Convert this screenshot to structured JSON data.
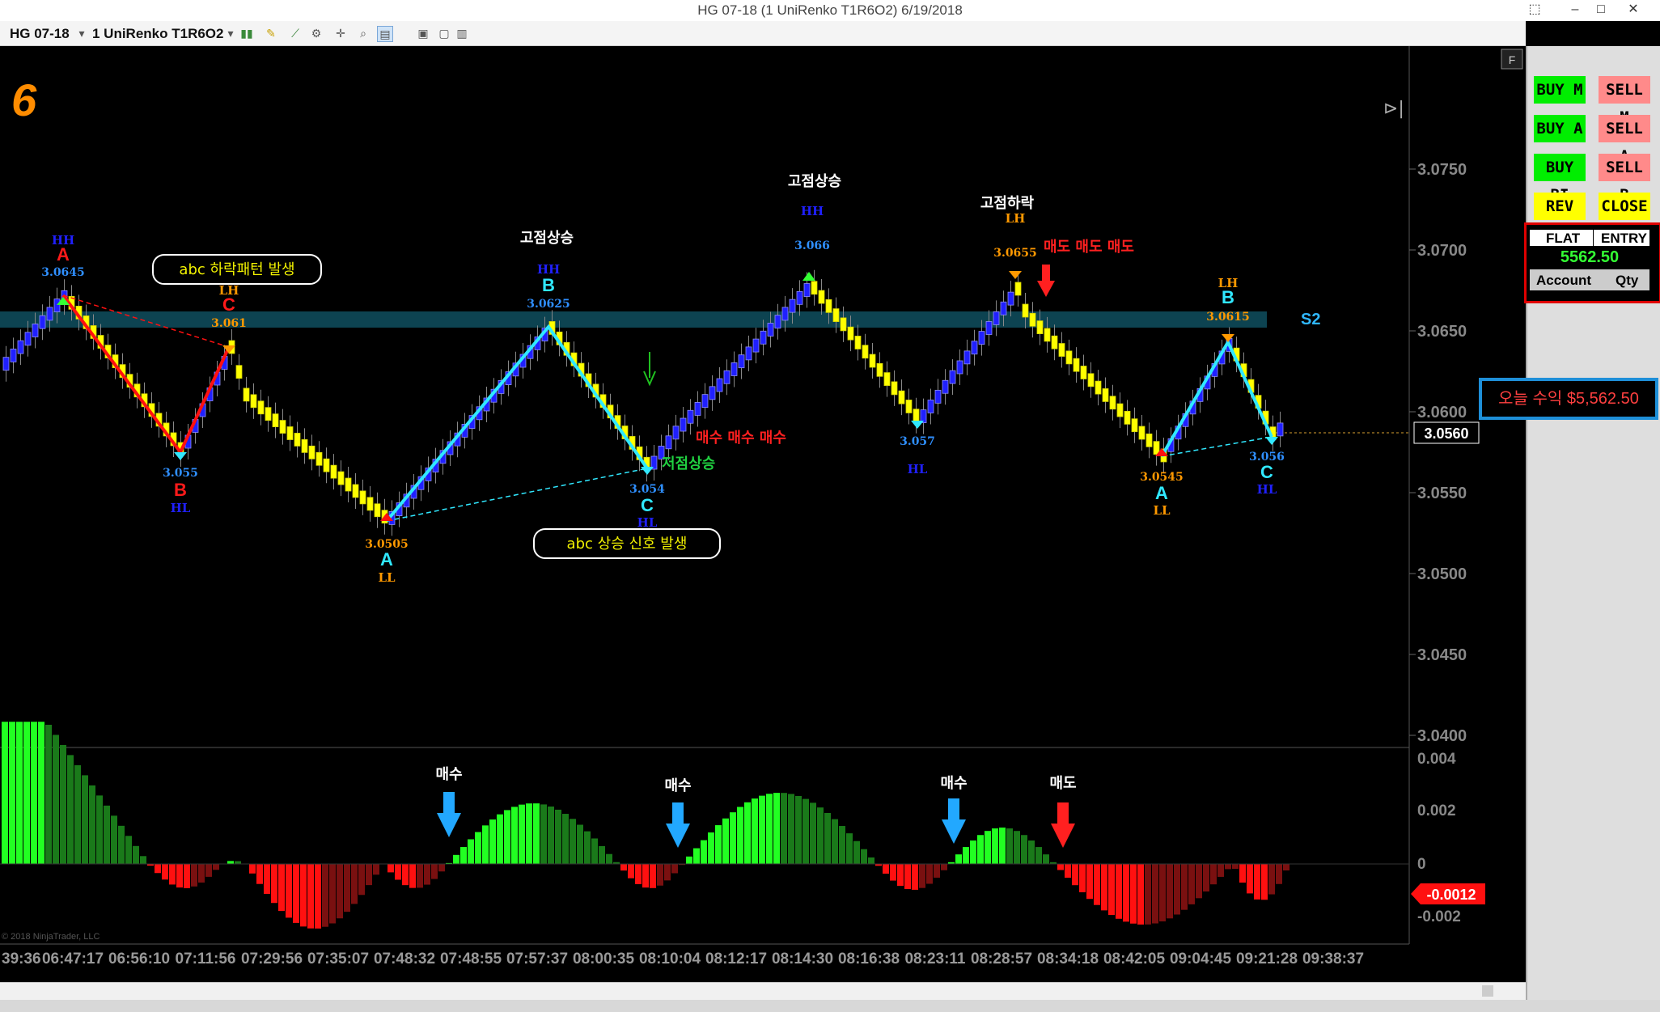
{
  "window": {
    "title": "HG 07-18 (1 UniRenko T1R6O2)  6/19/2018"
  },
  "toolbar": {
    "instrument": "HG 07-18",
    "bartype": "1 UniRenko T1R6O2"
  },
  "chart": {
    "tab_number": "6",
    "copyright": "© 2018 NinjaTrader, LLC",
    "price_axis": [
      "3.0750",
      "3.0700",
      "3.0650",
      "3.0600",
      "3.0550",
      "3.0500",
      "3.0450",
      "3.0400"
    ],
    "current_price": "3.0560",
    "indicator_axis": [
      "0.004",
      "0.002",
      "0",
      "-0.002"
    ],
    "indicator_value": "-0.0012",
    "time_axis": [
      "39:36",
      "06:47:17",
      "06:56:10",
      "07:11:56",
      "07:29:56",
      "07:35:07",
      "07:48:32",
      "07:48:55",
      "07:57:37",
      "08:00:35",
      "08:10:04",
      "08:12:17",
      "08:14:30",
      "08:16:38",
      "08:23:11",
      "08:28:57",
      "08:34:18",
      "08:42:05",
      "09:04:45",
      "09:21:28",
      "09:38:37"
    ],
    "zone_label": "S2",
    "annotations": {
      "abc_down": "abc 하락패턴 발생",
      "abc_up": "abc 상승 신호 발생",
      "high_up": "고점상승",
      "high_down": "고점하락",
      "low_up": "저점상승",
      "buy_text": "매수 매수 매수",
      "sell_text": "매도 매도 매도",
      "buy": "매수",
      "sell": "매도"
    },
    "pivots": {
      "p1": {
        "letter": "A",
        "tag": "HH",
        "price": "3.0645"
      },
      "p2": {
        "letter": "B",
        "tag": "HL",
        "price": "3.055"
      },
      "p3": {
        "letter": "C",
        "tag": "LH",
        "price": "3.061"
      },
      "p4": {
        "letter": "A",
        "tag": "LL",
        "price": "3.0505"
      },
      "p5": {
        "letter": "B",
        "tag": "HH",
        "price": "3.0625"
      },
      "p6": {
        "letter": "C",
        "tag": "HL",
        "price": "3.054"
      },
      "p7": {
        "tag": "HH",
        "price": "3.066"
      },
      "p8": {
        "tag": "HL",
        "price": "3.057"
      },
      "p9": {
        "tag": "LH",
        "price": "3.0655"
      },
      "p10": {
        "letter": "A",
        "tag": "LL",
        "price": "3.0545"
      },
      "p11": {
        "letter": "B",
        "tag": "LH",
        "price": "3.0615"
      },
      "p12": {
        "letter": "C",
        "tag": "HL",
        "price": "3.056"
      }
    }
  },
  "side_panel": {
    "buttons": [
      {
        "label": "BUY M",
        "color": "#00ee00"
      },
      {
        "label": "SELL M",
        "color": "#ff8a8a"
      },
      {
        "label": "BUY A",
        "color": "#00ee00"
      },
      {
        "label": "SELL A",
        "color": "#ff8a8a"
      },
      {
        "label": "BUY BI",
        "color": "#00ee00"
      },
      {
        "label": "SELL B",
        "color": "#ff8a8a"
      },
      {
        "label": "REV",
        "color": "#ffff00"
      },
      {
        "label": "CLOSE",
        "color": "#ffff00"
      }
    ],
    "position": "FLAT",
    "entry": "ENTRY",
    "pnl": "5562.50",
    "account": "Account",
    "qty": "Qty",
    "profit_label": "오늘 수익 $5,562.50"
  }
}
